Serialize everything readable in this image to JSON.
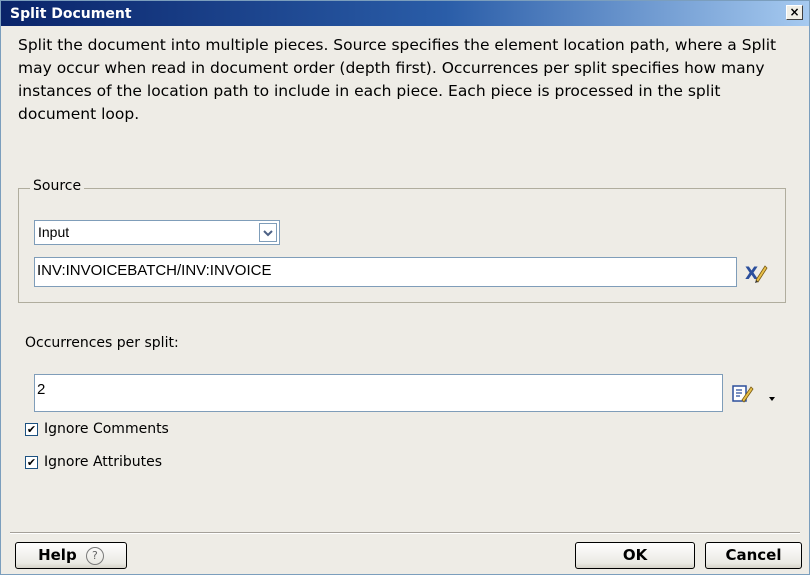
{
  "window": {
    "title": "Split Document",
    "close_label": "×"
  },
  "description": "Split the document into multiple pieces. Source specifies the element location path, where a Split may occur when read in document order (depth first). Occurrences per split specifies how many instances of the location path to include in each piece. Each piece is processed in the split document loop.",
  "source": {
    "legend": "Source",
    "select_value": "Input",
    "path_value": "INV:INVOICEBATCH/INV:INVOICE"
  },
  "occurrences": {
    "label": "Occurrences per split:",
    "value": "2"
  },
  "checkboxes": [
    {
      "label": "Ignore Comments",
      "checked": true
    },
    {
      "label": "Ignore Attributes",
      "checked": true
    }
  ],
  "buttons": {
    "help": "Help",
    "help_glyph": "?",
    "ok": "OK",
    "cancel": "Cancel"
  },
  "colors": {
    "title_start": "#0a246a",
    "title_end": "#a6caf0",
    "dialog_bg": "#eeece6"
  }
}
